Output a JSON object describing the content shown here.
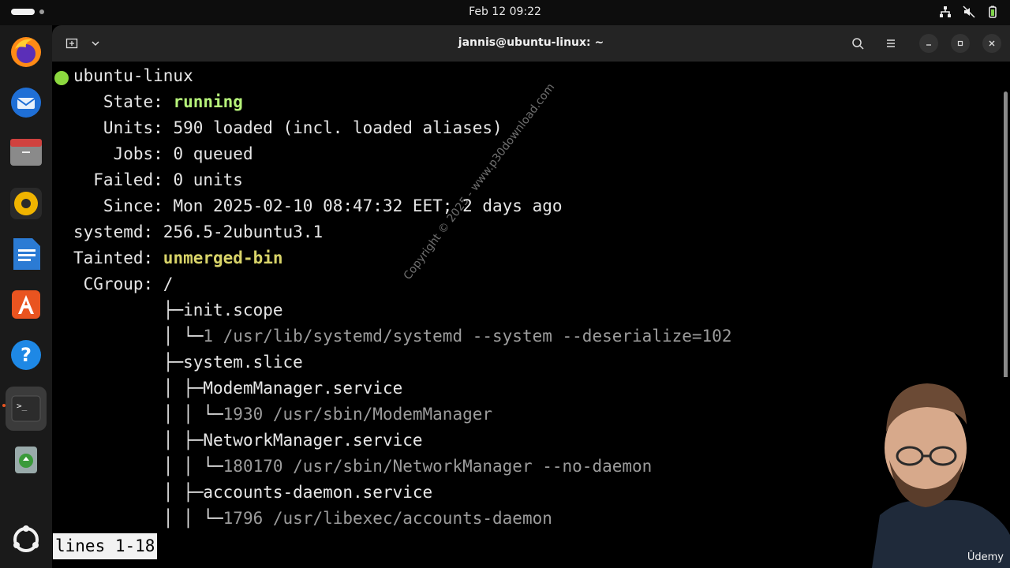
{
  "topbar": {
    "clock": "Feb 12  09:22"
  },
  "dock": {
    "items": [
      {
        "name": "firefox"
      },
      {
        "name": "thunderbird"
      },
      {
        "name": "files"
      },
      {
        "name": "rhythmbox"
      },
      {
        "name": "libreoffice-writer"
      },
      {
        "name": "app-center"
      },
      {
        "name": "help"
      },
      {
        "name": "terminal"
      },
      {
        "name": "trash"
      },
      {
        "name": "show-apps"
      }
    ]
  },
  "window": {
    "title": "jannis@ubuntu-linux: ~"
  },
  "terminal": {
    "host": "ubuntu-linux",
    "status": [
      {
        "key": "   State: ",
        "value": "running",
        "style": "green"
      },
      {
        "key": "   Units: ",
        "value": "590 loaded (incl. loaded aliases)",
        "style": ""
      },
      {
        "key": "    Jobs: ",
        "value": "0 queued",
        "style": ""
      },
      {
        "key": "  Failed: ",
        "value": "0 units",
        "style": ""
      },
      {
        "key": "   Since: ",
        "value": "Mon 2025-02-10 08:47:32 EET; 2 days ago",
        "style": ""
      },
      {
        "key": "systemd: ",
        "value": "256.5-2ubuntu3.1",
        "style": ""
      },
      {
        "key": "Tainted: ",
        "value": "unmerged-bin",
        "style": "yellow"
      },
      {
        "key": " CGroup: ",
        "value": "/",
        "style": ""
      }
    ],
    "tree": [
      {
        "prefix": "         ├─",
        "text": "init.scope",
        "style": ""
      },
      {
        "prefix": "         │ └─",
        "text": "1 /usr/lib/systemd/systemd --system --deserialize=102",
        "style": "dim"
      },
      {
        "prefix": "         ├─",
        "text": "system.slice",
        "style": ""
      },
      {
        "prefix": "         │ ├─",
        "text": "ModemManager.service",
        "style": ""
      },
      {
        "prefix": "         │ │ └─",
        "text": "1930 /usr/sbin/ModemManager",
        "style": "dim"
      },
      {
        "prefix": "         │ ├─",
        "text": "NetworkManager.service",
        "style": ""
      },
      {
        "prefix": "         │ │ └─",
        "text": "180170 /usr/sbin/NetworkManager --no-daemon",
        "style": "dim"
      },
      {
        "prefix": "         │ ├─",
        "text": "accounts-daemon.service",
        "style": ""
      },
      {
        "prefix": "         │ │ └─",
        "text": "1796 /usr/libexec/accounts-daemon",
        "style": "dim"
      }
    ],
    "pager": "lines 1-18"
  },
  "overlay": {
    "watermark": "Copyright © 2025 - www.p30download.com",
    "brand": "Ûdemy"
  }
}
